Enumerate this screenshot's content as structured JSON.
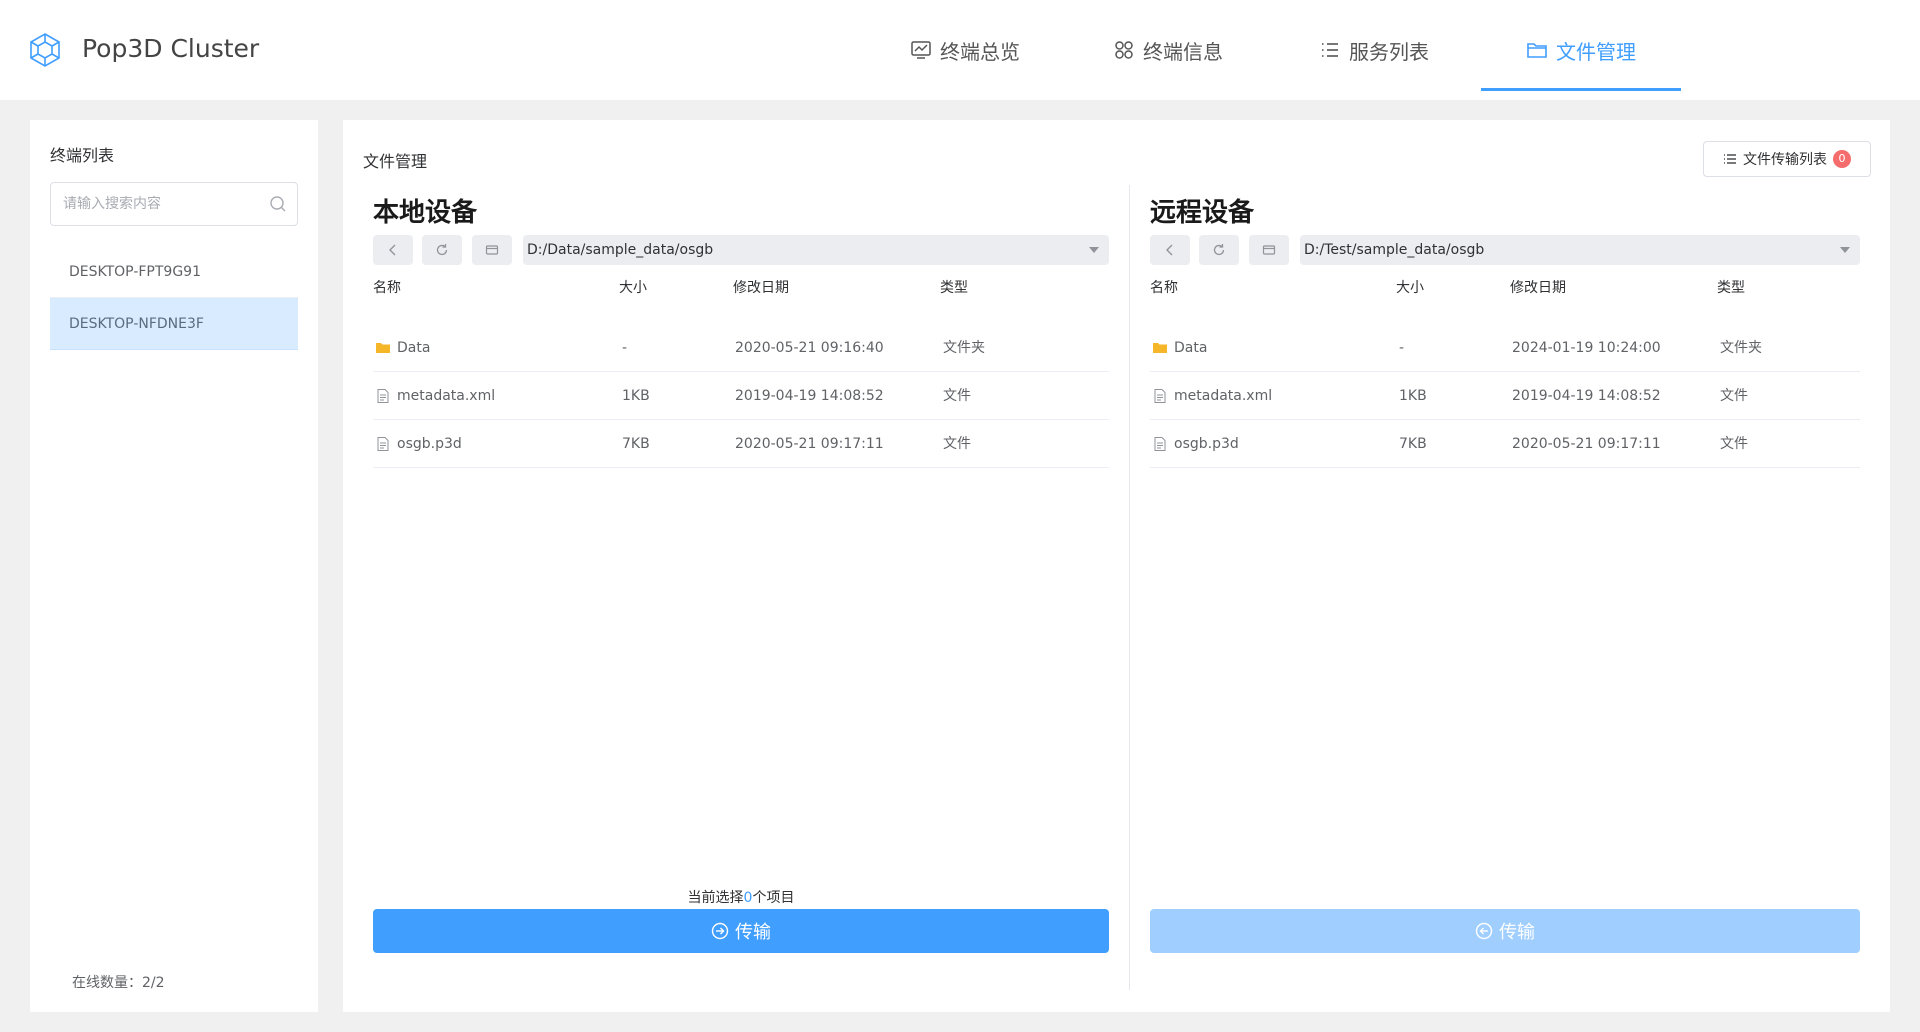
{
  "app": {
    "brand": "Pop3D Cluster",
    "logo_icon": "hex-cluster-icon"
  },
  "nav": [
    {
      "label": "终端总览",
      "icon": "monitor-chart-icon",
      "active": false
    },
    {
      "label": "终端信息",
      "icon": "grid-icon",
      "active": false
    },
    {
      "label": "服务列表",
      "icon": "list-icon",
      "active": false
    },
    {
      "label": "文件管理",
      "icon": "folder-icon",
      "active": true
    }
  ],
  "sidebar": {
    "title": "终端列表",
    "search_placeholder": "请输入搜索内容",
    "terminals": [
      {
        "name": "DESKTOP-FPT9G91",
        "selected": false
      },
      {
        "name": "DESKTOP-NFDNE3F",
        "selected": true
      }
    ],
    "online_count": "在线数量：2/2"
  },
  "main": {
    "title": "文件管理",
    "queue_button": "文件传输列表",
    "queue_count": "0",
    "columns": {
      "name": "名称",
      "size": "大小",
      "modified": "修改日期",
      "type": "类型"
    },
    "local": {
      "title": "本地设备",
      "path": "D:/Data/sample_data/osgb",
      "files": [
        {
          "name": "Data",
          "size": "-",
          "modified": "2020-05-21 09:16:40",
          "type": "文件夹",
          "icon": "folder-icon"
        },
        {
          "name": "metadata.xml",
          "size": "1KB",
          "modified": "2019-04-19 14:08:52",
          "type": "文件",
          "icon": "file-icon"
        },
        {
          "name": "osgb.p3d",
          "size": "7KB",
          "modified": "2020-05-21 09:17:11",
          "type": "文件",
          "icon": "file-icon"
        }
      ],
      "selection_prefix": "当前选择",
      "selection_count": "0",
      "selection_suffix": "个项目",
      "transfer_label": "传输"
    },
    "remote": {
      "title": "远程设备",
      "path": "D:/Test/sample_data/osgb",
      "files": [
        {
          "name": "Data",
          "size": "-",
          "modified": "2024-01-19 10:24:00",
          "type": "文件夹",
          "icon": "folder-icon"
        },
        {
          "name": "metadata.xml",
          "size": "1KB",
          "modified": "2019-04-19 14:08:52",
          "type": "文件",
          "icon": "file-icon"
        },
        {
          "name": "osgb.p3d",
          "size": "7KB",
          "modified": "2020-05-21 09:17:11",
          "type": "文件",
          "icon": "file-icon"
        }
      ],
      "transfer_label": "传输"
    }
  },
  "colors": {
    "accent": "#409eff",
    "accent_disabled": "#a0cfff",
    "selected_row": "#d9ecff",
    "badge": "#f56c6c",
    "folder": "#f5b62a"
  }
}
